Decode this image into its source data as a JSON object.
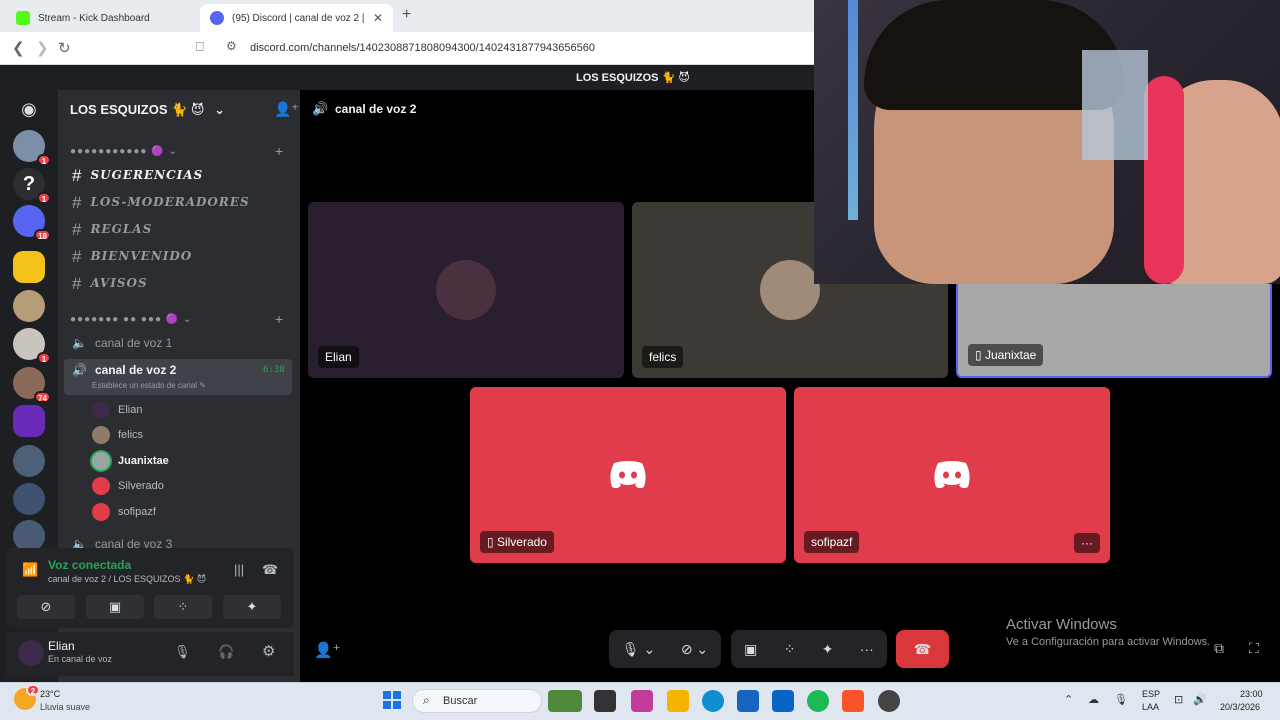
{
  "browser": {
    "tabs": [
      {
        "title": "Stream - Kick Dashboard",
        "active": false
      },
      {
        "title": "(95) Discord | canal de voz 2 |",
        "active": true
      }
    ],
    "url": "discord.com/channels/1402308871808094300/1402431877943656560"
  },
  "server": {
    "name": "LOS ESQUIZOS 🐈 😈",
    "topbar_name": "LOS ESQUIZOS 🐈 😈"
  },
  "guild_badges": [
    "1",
    "1",
    "18",
    "",
    "",
    "1",
    "74",
    "",
    "",
    "",
    ""
  ],
  "channels": {
    "category1": "●●●●●●●●●●● 🟣 ⌄",
    "text": [
      "SUGERENCIAS",
      "LOS-MODERADORES",
      "REGLAS",
      "BIENVENIDO",
      "AVISOS"
    ],
    "category2": "●●●●●●● ●● ●●● 🟣 ⌄",
    "voice1": "canal de voz 1",
    "voice2": "canal de voz 2",
    "voice2_time": "6:38",
    "voice2_status": "Establece un estado de canal ✎",
    "voice3": "canal de voz 3",
    "members": [
      "Elian",
      "felics",
      "Juanixtae",
      "Silverado",
      "sofipazf"
    ]
  },
  "voice_panel": {
    "title": "Voz conectada",
    "subtitle": "canal de voz 2 / LOS ESQUIZOS 🐈 😈"
  },
  "user_panel": {
    "name": "Elian",
    "status": "En canal de voz"
  },
  "call": {
    "header": "canal de voz 2",
    "tiles": [
      {
        "name": "Elian"
      },
      {
        "name": "felics"
      },
      {
        "name": "Juanixtae"
      },
      {
        "name": "Silverado"
      },
      {
        "name": "sofipazf"
      }
    ],
    "more": "···"
  },
  "watermark": {
    "line1": "Activar Windows",
    "line2": "Ve a Configuración para activar Windows."
  },
  "taskbar": {
    "weather_temp": "23°C",
    "weather_desc": "Lluvia suave",
    "search": "Buscar",
    "lang1": "ESP",
    "lang2": "LAA",
    "time": "23:00",
    "date": "20/3/2026",
    "weather_badge": "2"
  },
  "colors": {
    "discord_red": "#e03c4b",
    "green": "#23a55a",
    "blurple": "#5865f2"
  }
}
